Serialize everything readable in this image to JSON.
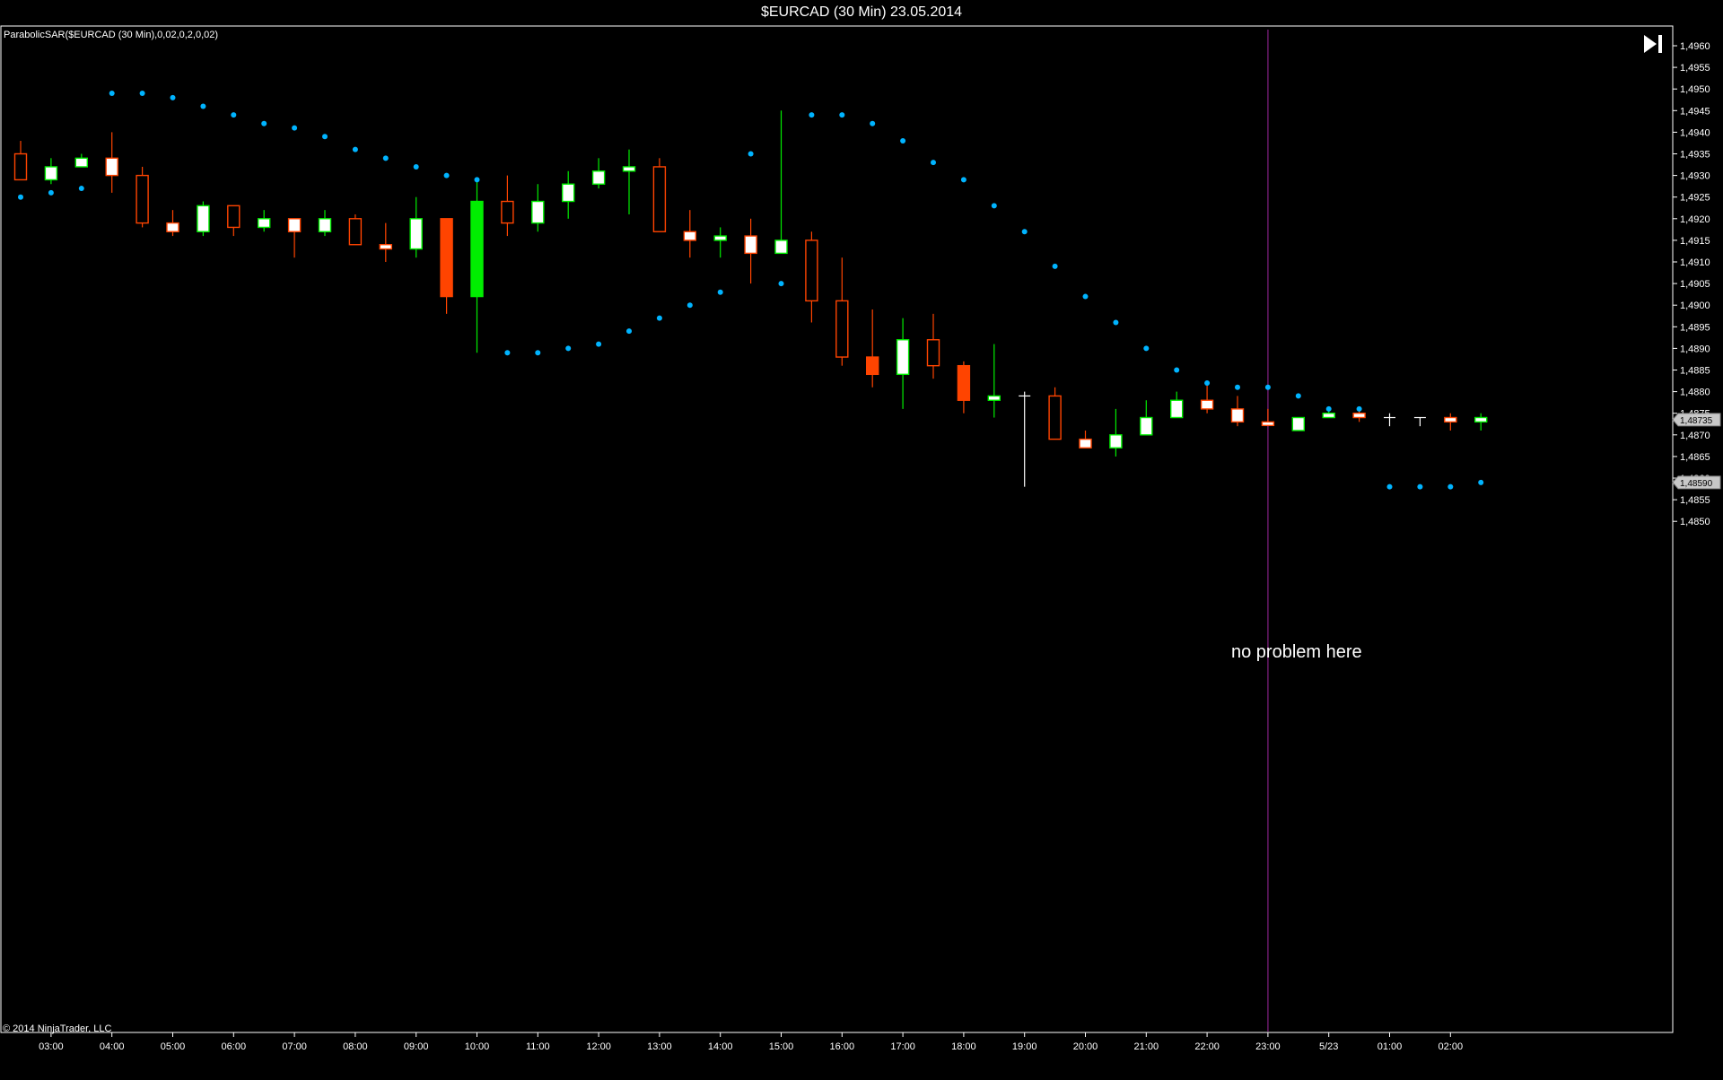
{
  "window": {
    "title": "$EURCAD (30 Min)  23.05.2014"
  },
  "indicator_label": "ParabolicSAR($EURCAD (30 Min),0,02,0,2,0,02)",
  "copyright": "© 2014 NinjaTrader, LLC",
  "annotation": "no problem here",
  "colors": {
    "background": "#000000",
    "up_candle": "#00ee00",
    "down_candle": "#ff4400",
    "doji": "#ffffff",
    "sar_dot": "#00b4ff",
    "session_line": "#6a1b6a",
    "axis": "#ffffff"
  },
  "price_markers": [
    {
      "label": "1,48735",
      "value": 1.48735
    },
    {
      "label": "1,48590",
      "value": 1.4859
    }
  ],
  "chart_data": {
    "type": "candlestick",
    "instrument": "$EURCAD",
    "timeframe": "30 Min",
    "date": "23.05.2014",
    "ylim": [
      1.4846,
      1.4961
    ],
    "y_ticks": [
      {
        "v": 1.496,
        "label": "1,4960"
      },
      {
        "v": 1.4955,
        "label": "1,4955"
      },
      {
        "v": 1.495,
        "label": "1,4950"
      },
      {
        "v": 1.4945,
        "label": "1,4945"
      },
      {
        "v": 1.494,
        "label": "1,4940"
      },
      {
        "v": 1.4935,
        "label": "1,4935"
      },
      {
        "v": 1.493,
        "label": "1,4930"
      },
      {
        "v": 1.4925,
        "label": "1,4925"
      },
      {
        "v": 1.492,
        "label": "1,4920"
      },
      {
        "v": 1.4915,
        "label": "1,4915"
      },
      {
        "v": 1.491,
        "label": "1,4910"
      },
      {
        "v": 1.4905,
        "label": "1,4905"
      },
      {
        "v": 1.49,
        "label": "1,4900"
      },
      {
        "v": 1.4895,
        "label": "1,4895"
      },
      {
        "v": 1.489,
        "label": "1,4890"
      },
      {
        "v": 1.4885,
        "label": "1,4885"
      },
      {
        "v": 1.488,
        "label": "1,4880"
      },
      {
        "v": 1.4875,
        "label": "1,4875"
      },
      {
        "v": 1.487,
        "label": "1,4870"
      },
      {
        "v": 1.4865,
        "label": "1,4865"
      },
      {
        "v": 1.486,
        "label": "1,4860"
      },
      {
        "v": 1.4855,
        "label": "1,4855"
      },
      {
        "v": 1.485,
        "label": "1,4850"
      }
    ],
    "x_ticks": [
      {
        "bar": 1,
        "label": "03:00"
      },
      {
        "bar": 3,
        "label": "04:00"
      },
      {
        "bar": 5,
        "label": "05:00"
      },
      {
        "bar": 7,
        "label": "06:00"
      },
      {
        "bar": 9,
        "label": "07:00"
      },
      {
        "bar": 11,
        "label": "08:00"
      },
      {
        "bar": 13,
        "label": "09:00"
      },
      {
        "bar": 15,
        "label": "10:00"
      },
      {
        "bar": 17,
        "label": "11:00"
      },
      {
        "bar": 19,
        "label": "12:00"
      },
      {
        "bar": 21,
        "label": "13:00"
      },
      {
        "bar": 23,
        "label": "14:00"
      },
      {
        "bar": 25,
        "label": "15:00"
      },
      {
        "bar": 27,
        "label": "16:00"
      },
      {
        "bar": 29,
        "label": "17:00"
      },
      {
        "bar": 31,
        "label": "18:00"
      },
      {
        "bar": 33,
        "label": "19:00"
      },
      {
        "bar": 35,
        "label": "20:00"
      },
      {
        "bar": 37,
        "label": "21:00"
      },
      {
        "bar": 39,
        "label": "22:00"
      },
      {
        "bar": 41,
        "label": "23:00"
      },
      {
        "bar": 43,
        "label": "5/23"
      },
      {
        "bar": 45,
        "label": "01:00"
      },
      {
        "bar": 47,
        "label": "02:00"
      }
    ],
    "session_break_bar": 41,
    "candles": [
      {
        "o": 1.4929,
        "h": 1.4938,
        "l": 1.4929,
        "c": 1.4935,
        "style": "hollow_down"
      },
      {
        "o": 1.4929,
        "h": 1.4934,
        "l": 1.4928,
        "c": 1.4932,
        "style": "hollow_up"
      },
      {
        "o": 1.4932,
        "h": 1.4935,
        "l": 1.4932,
        "c": 1.4934,
        "style": "hollow_up"
      },
      {
        "o": 1.4934,
        "h": 1.494,
        "l": 1.4926,
        "c": 1.493,
        "style": "hollow_down"
      },
      {
        "o": 1.493,
        "h": 1.4932,
        "l": 1.4918,
        "c": 1.4919,
        "style": "hollow_down"
      },
      {
        "o": 1.4919,
        "h": 1.4922,
        "l": 1.4916,
        "c": 1.4917,
        "style": "hollow_down"
      },
      {
        "o": 1.4917,
        "h": 1.4924,
        "l": 1.4916,
        "c": 1.4923,
        "style": "hollow_up"
      },
      {
        "o": 1.4923,
        "h": 1.4923,
        "l": 1.4916,
        "c": 1.4918,
        "style": "hollow_down"
      },
      {
        "o": 1.4918,
        "h": 1.4922,
        "l": 1.4917,
        "c": 1.492,
        "style": "hollow_up"
      },
      {
        "o": 1.492,
        "h": 1.492,
        "l": 1.4911,
        "c": 1.4917,
        "style": "hollow_down"
      },
      {
        "o": 1.4917,
        "h": 1.4922,
        "l": 1.4916,
        "c": 1.492,
        "style": "hollow_up"
      },
      {
        "o": 1.492,
        "h": 1.4921,
        "l": 1.4914,
        "c": 1.4914,
        "style": "hollow_down"
      },
      {
        "o": 1.4914,
        "h": 1.4919,
        "l": 1.491,
        "c": 1.4913,
        "style": "hollow_down"
      },
      {
        "o": 1.4913,
        "h": 1.4925,
        "l": 1.4911,
        "c": 1.492,
        "style": "hollow_up"
      },
      {
        "o": 1.492,
        "h": 1.492,
        "l": 1.4898,
        "c": 1.4902,
        "style": "filled_down"
      },
      {
        "o": 1.4902,
        "h": 1.4929,
        "l": 1.4889,
        "c": 1.4924,
        "style": "filled_up"
      },
      {
        "o": 1.4924,
        "h": 1.493,
        "l": 1.4916,
        "c": 1.4919,
        "style": "hollow_down"
      },
      {
        "o": 1.4919,
        "h": 1.4928,
        "l": 1.4917,
        "c": 1.4924,
        "style": "hollow_up"
      },
      {
        "o": 1.4924,
        "h": 1.4931,
        "l": 1.492,
        "c": 1.4928,
        "style": "hollow_up"
      },
      {
        "o": 1.4928,
        "h": 1.4934,
        "l": 1.4927,
        "c": 1.4931,
        "style": "hollow_up"
      },
      {
        "o": 1.4931,
        "h": 1.4936,
        "l": 1.4921,
        "c": 1.4932,
        "style": "hollow_up"
      },
      {
        "o": 1.4932,
        "h": 1.4934,
        "l": 1.4917,
        "c": 1.4917,
        "style": "hollow_down"
      },
      {
        "o": 1.4917,
        "h": 1.4922,
        "l": 1.4911,
        "c": 1.4915,
        "style": "hollow_down"
      },
      {
        "o": 1.4915,
        "h": 1.4918,
        "l": 1.4911,
        "c": 1.4916,
        "style": "hollow_up"
      },
      {
        "o": 1.4916,
        "h": 1.492,
        "l": 1.4905,
        "c": 1.4912,
        "style": "hollow_down"
      },
      {
        "o": 1.4912,
        "h": 1.4945,
        "l": 1.4912,
        "c": 1.4915,
        "style": "hollow_up"
      },
      {
        "o": 1.4915,
        "h": 1.4917,
        "l": 1.4896,
        "c": 1.4901,
        "style": "hollow_down"
      },
      {
        "o": 1.4901,
        "h": 1.4911,
        "l": 1.4886,
        "c": 1.4888,
        "style": "hollow_down"
      },
      {
        "o": 1.4888,
        "h": 1.4899,
        "l": 1.4881,
        "c": 1.4884,
        "style": "filled_down"
      },
      {
        "o": 1.4884,
        "h": 1.4897,
        "l": 1.4876,
        "c": 1.4892,
        "style": "hollow_up"
      },
      {
        "o": 1.4892,
        "h": 1.4898,
        "l": 1.4883,
        "c": 1.4886,
        "style": "hollow_down"
      },
      {
        "o": 1.4886,
        "h": 1.4887,
        "l": 1.4875,
        "c": 1.4878,
        "style": "filled_down"
      },
      {
        "o": 1.4878,
        "h": 1.4891,
        "l": 1.4874,
        "c": 1.4879,
        "style": "hollow_up"
      },
      {
        "o": 1.4879,
        "h": 1.488,
        "l": 1.4858,
        "c": 1.4879,
        "style": "doji"
      },
      {
        "o": 1.4879,
        "h": 1.4881,
        "l": 1.4869,
        "c": 1.4869,
        "style": "hollow_down"
      },
      {
        "o": 1.4869,
        "h": 1.4871,
        "l": 1.4867,
        "c": 1.4867,
        "style": "hollow_down"
      },
      {
        "o": 1.4867,
        "h": 1.4876,
        "l": 1.4865,
        "c": 1.487,
        "style": "hollow_up"
      },
      {
        "o": 1.487,
        "h": 1.4878,
        "l": 1.487,
        "c": 1.4874,
        "style": "hollow_up"
      },
      {
        "o": 1.4874,
        "h": 1.488,
        "l": 1.4874,
        "c": 1.4878,
        "style": "hollow_up"
      },
      {
        "o": 1.4878,
        "h": 1.4882,
        "l": 1.4875,
        "c": 1.4876,
        "style": "hollow_down"
      },
      {
        "o": 1.4876,
        "h": 1.4879,
        "l": 1.4872,
        "c": 1.4873,
        "style": "hollow_down"
      },
      {
        "o": 1.4873,
        "h": 1.4876,
        "l": 1.4872,
        "c": 1.4873,
        "style": "hollow_down"
      },
      {
        "o": 1.4871,
        "h": 1.4874,
        "l": 1.4871,
        "c": 1.4874,
        "style": "hollow_up"
      },
      {
        "o": 1.4874,
        "h": 1.4876,
        "l": 1.4874,
        "c": 1.4875,
        "style": "hollow_up"
      },
      {
        "o": 1.4875,
        "h": 1.4876,
        "l": 1.4873,
        "c": 1.4874,
        "style": "hollow_down"
      },
      {
        "o": 1.4874,
        "h": 1.4875,
        "l": 1.4872,
        "c": 1.4874,
        "style": "doji"
      },
      {
        "o": 1.4874,
        "h": 1.4874,
        "l": 1.4872,
        "c": 1.4874,
        "style": "doji"
      },
      {
        "o": 1.4874,
        "h": 1.4875,
        "l": 1.4871,
        "c": 1.4873,
        "style": "hollow_down"
      },
      {
        "o": 1.4873,
        "h": 1.4875,
        "l": 1.4871,
        "c": 1.4874,
        "style": "hollow_up"
      }
    ],
    "sar": [
      1.4925,
      1.4926,
      1.4927,
      1.4949,
      1.4949,
      1.4948,
      1.4946,
      1.4944,
      1.4942,
      1.4941,
      1.4939,
      1.4936,
      1.4934,
      1.4932,
      1.493,
      1.4929,
      1.4889,
      1.4889,
      1.489,
      1.4891,
      1.4894,
      1.4897,
      1.49,
      1.4903,
      1.4935,
      1.4905,
      1.4944,
      1.4944,
      1.4942,
      1.4938,
      1.4933,
      1.4929,
      1.4923,
      1.4917,
      1.4909,
      1.4902,
      1.4896,
      1.489,
      1.4885,
      1.4882,
      1.4881,
      1.4881,
      1.4879,
      1.4876,
      1.4876,
      1.4858,
      1.4858,
      1.4858,
      1.4859
    ]
  }
}
